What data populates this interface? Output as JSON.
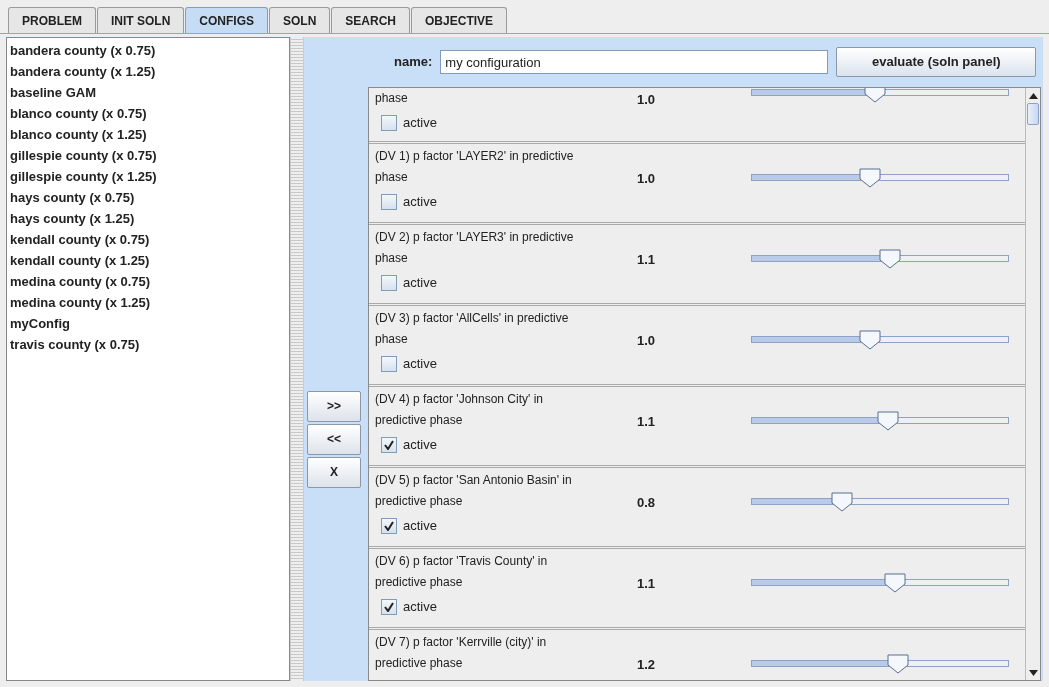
{
  "tabs": [
    {
      "label": "PROBLEM",
      "selected": false
    },
    {
      "label": "INIT SOLN",
      "selected": false
    },
    {
      "label": "CONFIGS",
      "selected": true
    },
    {
      "label": "SOLN",
      "selected": false
    },
    {
      "label": "SEARCH",
      "selected": false
    },
    {
      "label": "OBJECTIVE",
      "selected": false
    }
  ],
  "configs": [
    "bandera county (x 0.75)",
    "bandera county (x 1.25)",
    "baseline GAM",
    "blanco county (x 0.75)",
    "blanco county (x 1.25)",
    "gillespie county (x 0.75)",
    "gillespie county (x 1.25)",
    "hays county (x 0.75)",
    "hays county (x 1.25)",
    "kendall county (x 0.75)",
    "kendall county (x 1.25)",
    "medina county (x 0.75)",
    "medina county (x 1.25)",
    "myConfig",
    "travis county (x 0.75)"
  ],
  "transfer_buttons": [
    ">>",
    "<<",
    "X"
  ],
  "name": {
    "label": "name:",
    "value": "my configuration"
  },
  "evaluate_button": "evaluate (soln panel)",
  "factors": [
    {
      "description": "phase",
      "value": "1.0",
      "level": 0.48,
      "active_label": "active",
      "active": false
    },
    {
      "description": "(DV 1) p factor 'LAYER2' in predictive phase",
      "value": "1.0",
      "level": 0.46,
      "active_label": "active",
      "active": false
    },
    {
      "description": "(DV 2) p factor 'LAYER3' in predictive phase",
      "value": "1.1",
      "level": 0.54,
      "active_label": "active",
      "active": false
    },
    {
      "description": "(DV 3) p factor 'AllCells' in predictive phase",
      "value": "1.0",
      "level": 0.46,
      "active_label": "active",
      "active": false
    },
    {
      "description": "(DV 4) p factor 'Johnson City' in predictive phase",
      "value": "1.1",
      "level": 0.53,
      "active_label": "active",
      "active": true
    },
    {
      "description": "(DV 5) p factor 'San Antonio Basin' in predictive phase",
      "value": "0.8",
      "level": 0.35,
      "active_label": "active",
      "active": true
    },
    {
      "description": "(DV 6) p factor 'Travis County' in predictive phase",
      "value": "1.1",
      "level": 0.56,
      "active_label": "active",
      "active": true
    },
    {
      "description": "(DV 7) p factor 'Kerrville (city)' in predictive phase",
      "value": "1.2",
      "level": 0.57
    }
  ]
}
